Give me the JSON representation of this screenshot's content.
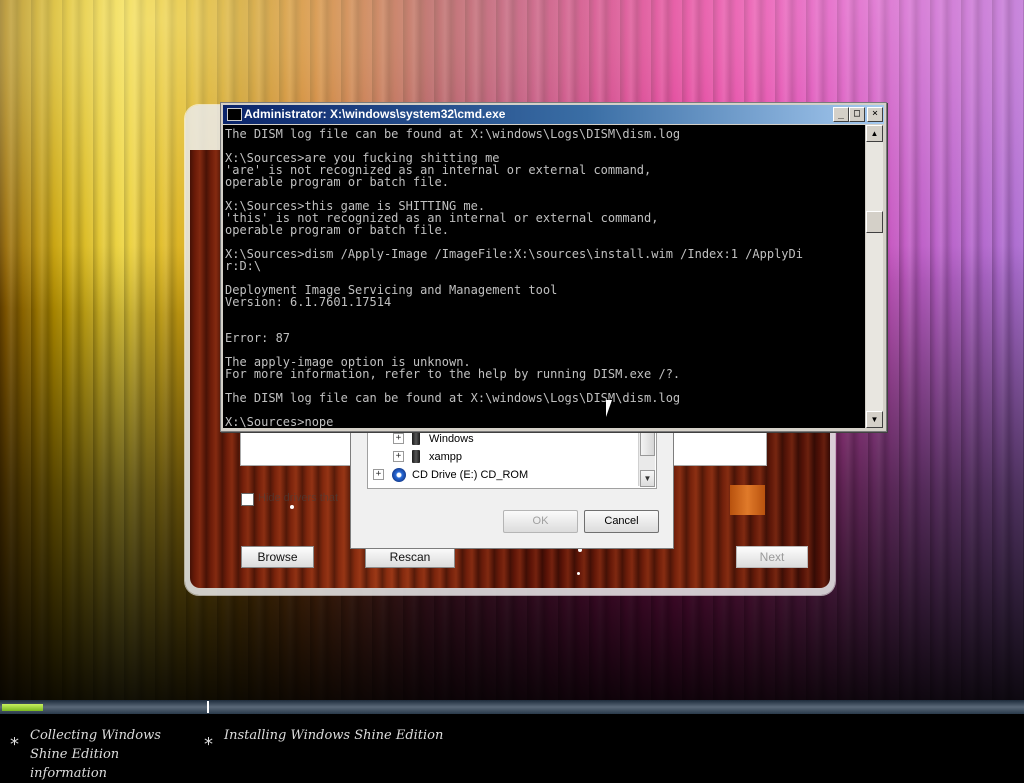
{
  "cmd": {
    "title": "Administrator: X:\\windows\\system32\\cmd.exe",
    "buttons": {
      "minimize": "_",
      "maximize": "□",
      "close": "×"
    },
    "lines": [
      "The DISM log file can be found at X:\\windows\\Logs\\DISM\\dism.log",
      "",
      "X:\\Sources>are you fucking shitting me",
      "'are' is not recognized as an internal or external command,",
      "operable program or batch file.",
      "",
      "X:\\Sources>this game is SHITTING me.",
      "'this' is not recognized as an internal or external command,",
      "operable program or batch file.",
      "",
      "X:\\Sources>dism /Apply-Image /ImageFile:X:\\sources\\install.wim /Index:1 /ApplyDi",
      "r:D:\\",
      "",
      "Deployment Image Servicing and Management tool",
      "Version: 6.1.7601.17514",
      "",
      "",
      "Error: 87",
      "",
      "The apply-image option is unknown.",
      "For more information, refer to the help by running DISM.exe /?.",
      "",
      "The DISM log file can be found at X:\\windows\\Logs\\DISM\\dism.log",
      "",
      "X:\\Sources>nope"
    ]
  },
  "browse_dialog": {
    "tree": [
      {
        "label": "Windows",
        "expander": "+",
        "icon": "folder-icon"
      },
      {
        "label": "xampp",
        "expander": "+",
        "icon": "folder-icon"
      },
      {
        "label": "CD Drive (E:) CD_ROM",
        "expander": "+",
        "icon": "cd-drive-icon"
      }
    ],
    "ok_label": "OK",
    "cancel_label": "Cancel"
  },
  "setup": {
    "hide_label": "Hide drivers that",
    "browse_label": "Browse",
    "rescan_label": "Rescan",
    "next_label": "Next"
  },
  "status": {
    "step1": "Collecting Windows Shine Edition information",
    "step2": "Installing Windows Shine Edition",
    "progress_step1": 0.2
  },
  "colors": {
    "console_bg": "#000000",
    "console_text": "#c0c0c0",
    "titlebar_start": "#0a246a",
    "progress_green": "#7ab820"
  }
}
